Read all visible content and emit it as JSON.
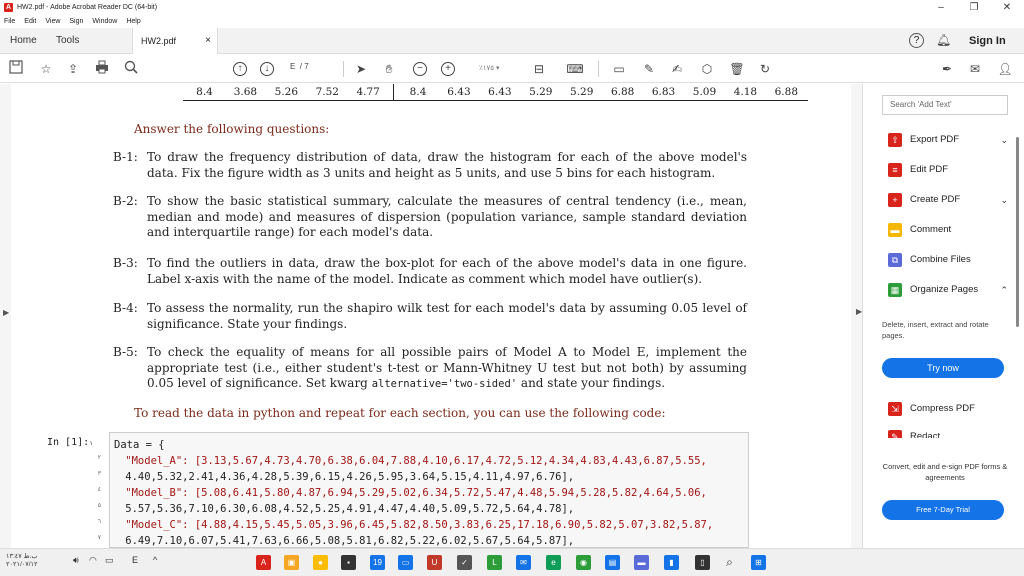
{
  "window": {
    "title": "HW2.pdf - Adobe Acrobat Reader DC (64-bit)",
    "minimize": "–",
    "restore": "❐",
    "close": "✕"
  },
  "menu": [
    "File",
    "Edit",
    "View",
    "Sign",
    "Window",
    "Help"
  ],
  "tabs": {
    "home": "Home",
    "tools": "Tools",
    "document": "HW2.pdf",
    "close": "×",
    "help": "?",
    "signin": "Sign In"
  },
  "toolbar": {
    "page_current": "E",
    "page_total": "/ 7",
    "zoom": "٪١٧٥"
  },
  "doc": {
    "data_row": [
      "8.4",
      "3.68",
      "5.26",
      "7.52",
      "4.77",
      "8.4",
      "6.43",
      "6.43",
      "5.29",
      "5.29",
      "6.88",
      "6.83",
      "5.09",
      "4.18",
      "6.88"
    ],
    "intro": "Answer the following questions:",
    "q1_label": "B-1:",
    "q1_text": "To draw the frequency distribution of data, draw the histogram for each of the above model's data. Fix the figure width as 3 units and height as 5 units, and use 5 bins for each histogram.",
    "q2_label": "B-2:",
    "q2_text": "To show the basic statistical summary, calculate the measures of central tendency (i.e., mean, median and mode) and measures of dispersion (population variance, sample standard deviation and interquartile range) for each model's data.",
    "q3_label": "B-3:",
    "q3_text": "To find the outliers in data, draw the box-plot for each of the above model's data in one figure. Label x-axis with the name of the model. Indicate as comment which model have outlier(s).",
    "q4_label": "B-4:",
    "q4_text": "To assess the normality, run the shapiro wilk test for each model's data by assuming 0.05 level of significance. State your findings.",
    "q5_label": "B-5:",
    "q5_text_a": "To check the equality of means for all possible pairs of Model A to Model E, implement the appropriate test (i.e., either student's t-test or Mann-Whitney U test but not both) by assuming 0.05 level of significance. Set kwarg ",
    "q5_code": "alternative='two-sided'",
    "q5_text_b": " and state your findings.",
    "outro": "To read the data in python and repeat for each section, you can use the following code:"
  },
  "code": {
    "prompt": "In [1]:",
    "prompt_num": "١",
    "lines": [
      {
        "n": "",
        "code": "Data = {"
      },
      {
        "n": "٢",
        "code": "    \"Model_A\": [3.13,5.67,4.73,4.70,6.38,6.04,7.88,4.10,6.17,4.72,5.12,4.34,4.83,4.43,6.87,5.55,"
      },
      {
        "n": "٣",
        "code": "    4.40,5.32,2.41,4.36,4.28,5.39,6.15,4.26,5.95,3.64,5.15,4.11,4.97,6.76],"
      },
      {
        "n": "٤",
        "code": "    \"Model_B\": [5.08,6.41,5.80,4.87,6.94,5.29,5.02,6.34,5.72,5.47,4.48,5.94,5.28,5.82,4.64,5.06,"
      },
      {
        "n": "٥",
        "code": "    5.57,5.36,7.10,6.30,6.08,4.52,5.25,4.91,4.47,4.40,5.09,5.72,5.64,4.78],"
      },
      {
        "n": "٦",
        "code": "    \"Model_C\": [4.88,4.15,5.45,5.05,3.96,6.45,5.82,8.50,3.83,6.25,17.18,6.90,5.82,5.07,3.82,5.87,"
      },
      {
        "n": "٧",
        "code": "    6.49,7.10,6.07,5.41,7.63,6.66,5.08,5.81,6.82,5.22,6.02,5.67,5.64,5.87],"
      }
    ]
  },
  "panel": {
    "search_placeholder": "Search 'Add Text'",
    "tools": [
      {
        "label": "Export PDF",
        "icon": "export-pdf-icon",
        "color": "#d9241c"
      },
      {
        "label": "Edit PDF",
        "icon": "edit-pdf-icon",
        "color": "#d9241c"
      },
      {
        "label": "Create PDF",
        "icon": "create-pdf-icon",
        "color": "#d9241c"
      },
      {
        "label": "Comment",
        "icon": "comment-icon",
        "color": "#f5b800"
      },
      {
        "label": "Combine Files",
        "icon": "combine-files-icon",
        "color": "#5a6bd8"
      },
      {
        "label": "Organize Pages",
        "icon": "organize-pages-icon",
        "color": "#2d9d3a"
      }
    ],
    "organize_desc": "Delete, insert, extract and rotate pages.",
    "try_now": "Try now",
    "compress": "Compress PDF",
    "redact": "Redact",
    "promo_text": "Convert, edit and e-sign PDF forms & agreements",
    "trial_button": "Free 7-Day Trial"
  },
  "taskbar": {
    "time": "ب.ظ ١٣:٤٧",
    "date": "٢٠٢١/٠٧/١٢",
    "lang": "E"
  }
}
